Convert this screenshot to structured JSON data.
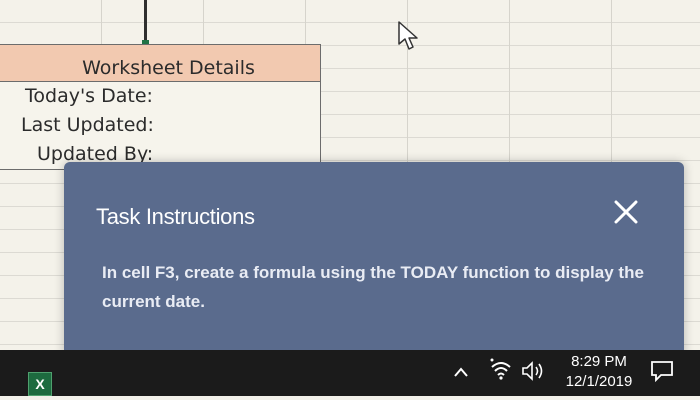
{
  "worksheet": {
    "header": "Worksheet Details",
    "rows": [
      "Today's Date:",
      "Last Updated:",
      "Updated By:"
    ]
  },
  "task": {
    "title": "Task Instructions",
    "text": "In cell F3, create a formula using the TODAY function to display the current date.",
    "close_icon": "close-icon"
  },
  "taskbar": {
    "app_icon": "excel-icon",
    "app_icon_label": "X",
    "time": "8:29 PM",
    "date": "12/1/2019",
    "tray_icons": [
      "chevron-up-icon",
      "wifi-icon",
      "speaker-icon",
      "notification-icon"
    ]
  },
  "colors": {
    "header_fill": "#f2c9b0",
    "panel": "#5a6b8d",
    "taskbar": "#1b1b1b"
  }
}
